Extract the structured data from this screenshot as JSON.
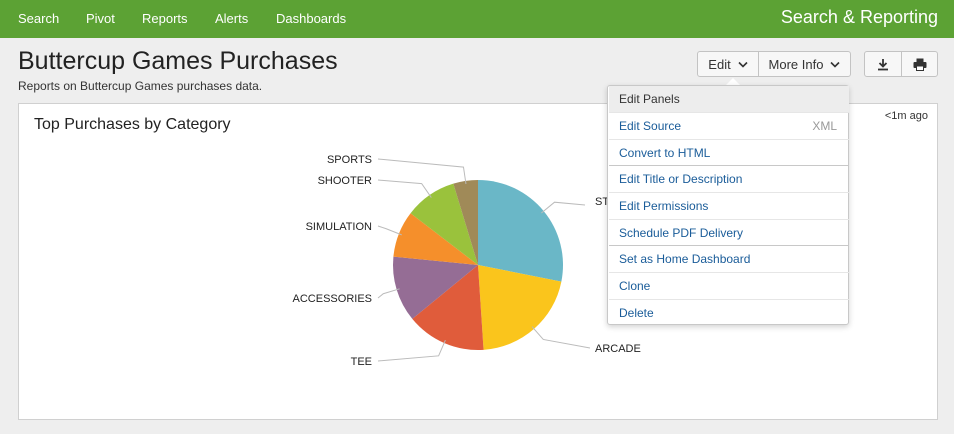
{
  "topbar": {
    "nav": [
      "Search",
      "Pivot",
      "Reports",
      "Alerts",
      "Dashboards"
    ],
    "app_title": "Search & Reporting"
  },
  "dashboard": {
    "title": "Buttercup Games Purchases",
    "description": "Reports on Buttercup Games purchases data.",
    "edit_label": "Edit",
    "more_info_label": "More Info"
  },
  "panel": {
    "title": "Top Purchases by Category",
    "time": "<1m ago"
  },
  "menu": {
    "items": [
      {
        "label": "Edit Panels"
      },
      {
        "label": "Edit Source",
        "extra": "XML"
      },
      {
        "label": "Convert to HTML"
      },
      {
        "label": "Edit Title or Description"
      },
      {
        "label": "Edit Permissions"
      },
      {
        "label": "Schedule PDF Delivery"
      },
      {
        "label": "Set as Home Dashboard"
      },
      {
        "label": "Clone"
      },
      {
        "label": "Delete"
      }
    ]
  },
  "icons": {
    "download": "download-icon",
    "print": "print-icon",
    "caret": "chevron-down-icon"
  },
  "colors": {
    "topbar": "#5ca234",
    "menu_link": "#1a5c99"
  },
  "chart_data": {
    "type": "pie",
    "slices": [
      {
        "label": "STRATEGY",
        "visible_label": "ST",
        "value": 27.0,
        "color": "#6ab7c7"
      },
      {
        "label": "ARCADE",
        "value": 20.0,
        "color": "#fac51c"
      },
      {
        "label": "TEE",
        "value": 14.5,
        "color": "#e05c3b"
      },
      {
        "label": "ACCESSORIES",
        "value": 12.0,
        "color": "#956d95"
      },
      {
        "label": "SIMULATION",
        "value": 8.5,
        "color": "#f58f2b"
      },
      {
        "label": "SHOOTER",
        "value": 9.5,
        "color": "#9ac23c"
      },
      {
        "label": "SPORTS",
        "value": 4.5,
        "color": "#a08a58"
      }
    ]
  }
}
